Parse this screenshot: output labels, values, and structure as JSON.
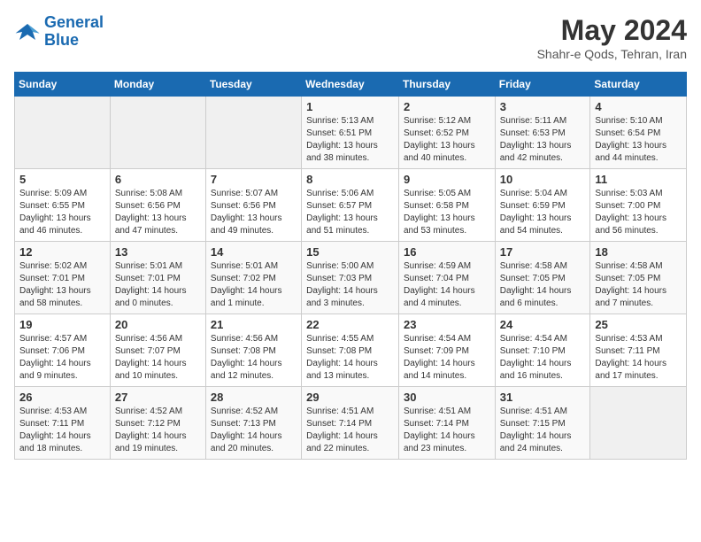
{
  "logo": {
    "line1": "General",
    "line2": "Blue"
  },
  "title": "May 2024",
  "location": "Shahr-e Qods, Tehran, Iran",
  "weekdays": [
    "Sunday",
    "Monday",
    "Tuesday",
    "Wednesday",
    "Thursday",
    "Friday",
    "Saturday"
  ],
  "weeks": [
    [
      {
        "day": "",
        "info": ""
      },
      {
        "day": "",
        "info": ""
      },
      {
        "day": "",
        "info": ""
      },
      {
        "day": "1",
        "info": "Sunrise: 5:13 AM\nSunset: 6:51 PM\nDaylight: 13 hours\nand 38 minutes."
      },
      {
        "day": "2",
        "info": "Sunrise: 5:12 AM\nSunset: 6:52 PM\nDaylight: 13 hours\nand 40 minutes."
      },
      {
        "day": "3",
        "info": "Sunrise: 5:11 AM\nSunset: 6:53 PM\nDaylight: 13 hours\nand 42 minutes."
      },
      {
        "day": "4",
        "info": "Sunrise: 5:10 AM\nSunset: 6:54 PM\nDaylight: 13 hours\nand 44 minutes."
      }
    ],
    [
      {
        "day": "5",
        "info": "Sunrise: 5:09 AM\nSunset: 6:55 PM\nDaylight: 13 hours\nand 46 minutes."
      },
      {
        "day": "6",
        "info": "Sunrise: 5:08 AM\nSunset: 6:56 PM\nDaylight: 13 hours\nand 47 minutes."
      },
      {
        "day": "7",
        "info": "Sunrise: 5:07 AM\nSunset: 6:56 PM\nDaylight: 13 hours\nand 49 minutes."
      },
      {
        "day": "8",
        "info": "Sunrise: 5:06 AM\nSunset: 6:57 PM\nDaylight: 13 hours\nand 51 minutes."
      },
      {
        "day": "9",
        "info": "Sunrise: 5:05 AM\nSunset: 6:58 PM\nDaylight: 13 hours\nand 53 minutes."
      },
      {
        "day": "10",
        "info": "Sunrise: 5:04 AM\nSunset: 6:59 PM\nDaylight: 13 hours\nand 54 minutes."
      },
      {
        "day": "11",
        "info": "Sunrise: 5:03 AM\nSunset: 7:00 PM\nDaylight: 13 hours\nand 56 minutes."
      }
    ],
    [
      {
        "day": "12",
        "info": "Sunrise: 5:02 AM\nSunset: 7:01 PM\nDaylight: 13 hours\nand 58 minutes."
      },
      {
        "day": "13",
        "info": "Sunrise: 5:01 AM\nSunset: 7:01 PM\nDaylight: 14 hours\nand 0 minutes."
      },
      {
        "day": "14",
        "info": "Sunrise: 5:01 AM\nSunset: 7:02 PM\nDaylight: 14 hours\nand 1 minute."
      },
      {
        "day": "15",
        "info": "Sunrise: 5:00 AM\nSunset: 7:03 PM\nDaylight: 14 hours\nand 3 minutes."
      },
      {
        "day": "16",
        "info": "Sunrise: 4:59 AM\nSunset: 7:04 PM\nDaylight: 14 hours\nand 4 minutes."
      },
      {
        "day": "17",
        "info": "Sunrise: 4:58 AM\nSunset: 7:05 PM\nDaylight: 14 hours\nand 6 minutes."
      },
      {
        "day": "18",
        "info": "Sunrise: 4:58 AM\nSunset: 7:05 PM\nDaylight: 14 hours\nand 7 minutes."
      }
    ],
    [
      {
        "day": "19",
        "info": "Sunrise: 4:57 AM\nSunset: 7:06 PM\nDaylight: 14 hours\nand 9 minutes."
      },
      {
        "day": "20",
        "info": "Sunrise: 4:56 AM\nSunset: 7:07 PM\nDaylight: 14 hours\nand 10 minutes."
      },
      {
        "day": "21",
        "info": "Sunrise: 4:56 AM\nSunset: 7:08 PM\nDaylight: 14 hours\nand 12 minutes."
      },
      {
        "day": "22",
        "info": "Sunrise: 4:55 AM\nSunset: 7:08 PM\nDaylight: 14 hours\nand 13 minutes."
      },
      {
        "day": "23",
        "info": "Sunrise: 4:54 AM\nSunset: 7:09 PM\nDaylight: 14 hours\nand 14 minutes."
      },
      {
        "day": "24",
        "info": "Sunrise: 4:54 AM\nSunset: 7:10 PM\nDaylight: 14 hours\nand 16 minutes."
      },
      {
        "day": "25",
        "info": "Sunrise: 4:53 AM\nSunset: 7:11 PM\nDaylight: 14 hours\nand 17 minutes."
      }
    ],
    [
      {
        "day": "26",
        "info": "Sunrise: 4:53 AM\nSunset: 7:11 PM\nDaylight: 14 hours\nand 18 minutes."
      },
      {
        "day": "27",
        "info": "Sunrise: 4:52 AM\nSunset: 7:12 PM\nDaylight: 14 hours\nand 19 minutes."
      },
      {
        "day": "28",
        "info": "Sunrise: 4:52 AM\nSunset: 7:13 PM\nDaylight: 14 hours\nand 20 minutes."
      },
      {
        "day": "29",
        "info": "Sunrise: 4:51 AM\nSunset: 7:14 PM\nDaylight: 14 hours\nand 22 minutes."
      },
      {
        "day": "30",
        "info": "Sunrise: 4:51 AM\nSunset: 7:14 PM\nDaylight: 14 hours\nand 23 minutes."
      },
      {
        "day": "31",
        "info": "Sunrise: 4:51 AM\nSunset: 7:15 PM\nDaylight: 14 hours\nand 24 minutes."
      },
      {
        "day": "",
        "info": ""
      }
    ]
  ]
}
